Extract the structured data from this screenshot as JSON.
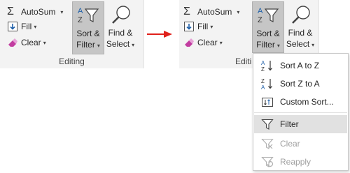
{
  "editing_before": {
    "autosum_label": "AutoSum",
    "fill_label": "Fill",
    "clear_label": "Clear",
    "sort_line1": "Sort &",
    "sort_line2": "Filter",
    "find_line1": "Find &",
    "find_line2": "Select",
    "group_label": "Editing"
  },
  "editing_after": {
    "autosum_label": "AutoSum",
    "fill_label": "Fill",
    "clear_label": "Clear",
    "sort_line1": "Sort &",
    "sort_line2": "Filter",
    "find_line1": "Find &",
    "find_line2": "Select",
    "group_label": "Editi"
  },
  "menu": {
    "items": [
      {
        "label": "Sort A to Z",
        "icon": "sort-ascending-icon",
        "state": "normal"
      },
      {
        "label": "Sort Z to A",
        "icon": "sort-descending-icon",
        "state": "normal"
      },
      {
        "label": "Custom Sort...",
        "icon": "custom-sort-icon",
        "state": "normal"
      },
      {
        "label": "Filter",
        "icon": "filter-icon",
        "state": "hover"
      },
      {
        "label": "Clear",
        "icon": "clear-filter-icon",
        "state": "disabled"
      },
      {
        "label": "Reapply",
        "icon": "reapply-icon",
        "state": "disabled"
      }
    ]
  },
  "colors": {
    "ribbon_bg": "#f3f3f3",
    "pressed_bg": "#c6c6c6",
    "hover_bg": "#e1e1e1",
    "arrow_red": "#e0201b",
    "accent_blue": "#1e5fa8",
    "eraser_pink": "#c23ca0"
  }
}
